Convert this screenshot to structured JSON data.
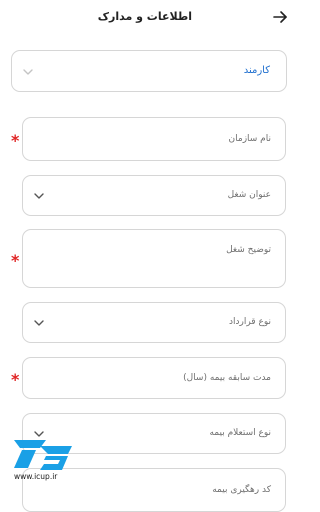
{
  "header": {
    "title": "اطلاعات و مدارک",
    "back_icon": "arrow-right-icon"
  },
  "employment_type": {
    "selected": "کارمند",
    "icon": "chevron-down-icon",
    "accent": "#1f6fcf"
  },
  "form": {
    "organization_name": {
      "label": "نام سازمان",
      "required": true
    },
    "job_title": {
      "label": "عنوان شغل",
      "icon": "chevron-down-icon"
    },
    "job_description": {
      "label": "توضیح شغل",
      "required": true
    },
    "contract_type": {
      "label": "نوع قرارداد",
      "icon": "chevron-down-icon"
    },
    "insurance_history": {
      "label": "مدت سابقه بیمه (سال)",
      "required": true
    },
    "insurance_inquiry_type": {
      "label": "نوع استعلام بیمه",
      "icon": "chevron-down-icon"
    },
    "tracking_code": {
      "label": "کد رهگیری بیمه"
    }
  },
  "watermark": {
    "url": "www.icup.ir",
    "logo_color": "#1aa0e6"
  },
  "colors": {
    "required": "#e02424",
    "border": "#d6d6d6"
  }
}
